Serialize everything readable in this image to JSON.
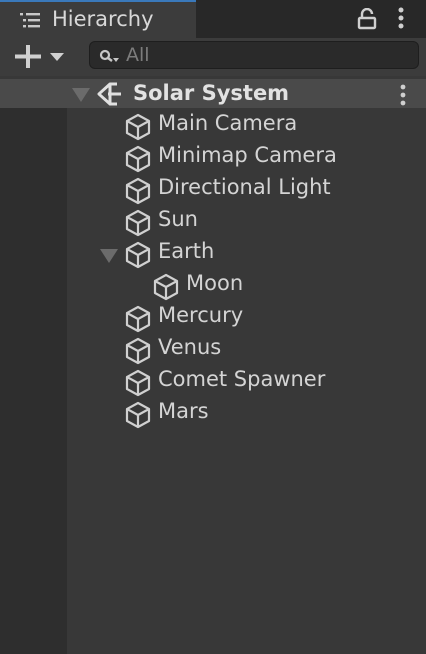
{
  "window": {
    "tab_title": "Hierarchy"
  },
  "search": {
    "placeholder": "All",
    "value": ""
  },
  "scene": {
    "name": "Solar System"
  },
  "hierarchy": {
    "items": [
      {
        "label": "Main Camera",
        "depth": 1
      },
      {
        "label": "Minimap Camera",
        "depth": 1
      },
      {
        "label": "Directional Light",
        "depth": 1
      },
      {
        "label": "Sun",
        "depth": 1
      },
      {
        "label": "Earth",
        "depth": 1,
        "expanded": true
      },
      {
        "label": "Moon",
        "depth": 2
      },
      {
        "label": "Mercury",
        "depth": 1
      },
      {
        "label": "Venus",
        "depth": 1
      },
      {
        "label": "Comet Spawner",
        "depth": 1
      },
      {
        "label": "Mars",
        "depth": 1
      }
    ]
  },
  "icons": {
    "tab": "hierarchy-list-icon",
    "lock": "lock-icon",
    "menu": "kebab-menu-icon",
    "add": "plus-icon",
    "search": "search-icon",
    "scene": "unity-logo-icon",
    "object": "gameobject-cube-icon"
  },
  "colors": {
    "accent_tab_border": "#3a79bb",
    "panel_bg": "#383838",
    "scene_row_bg": "#4a4a4a"
  }
}
